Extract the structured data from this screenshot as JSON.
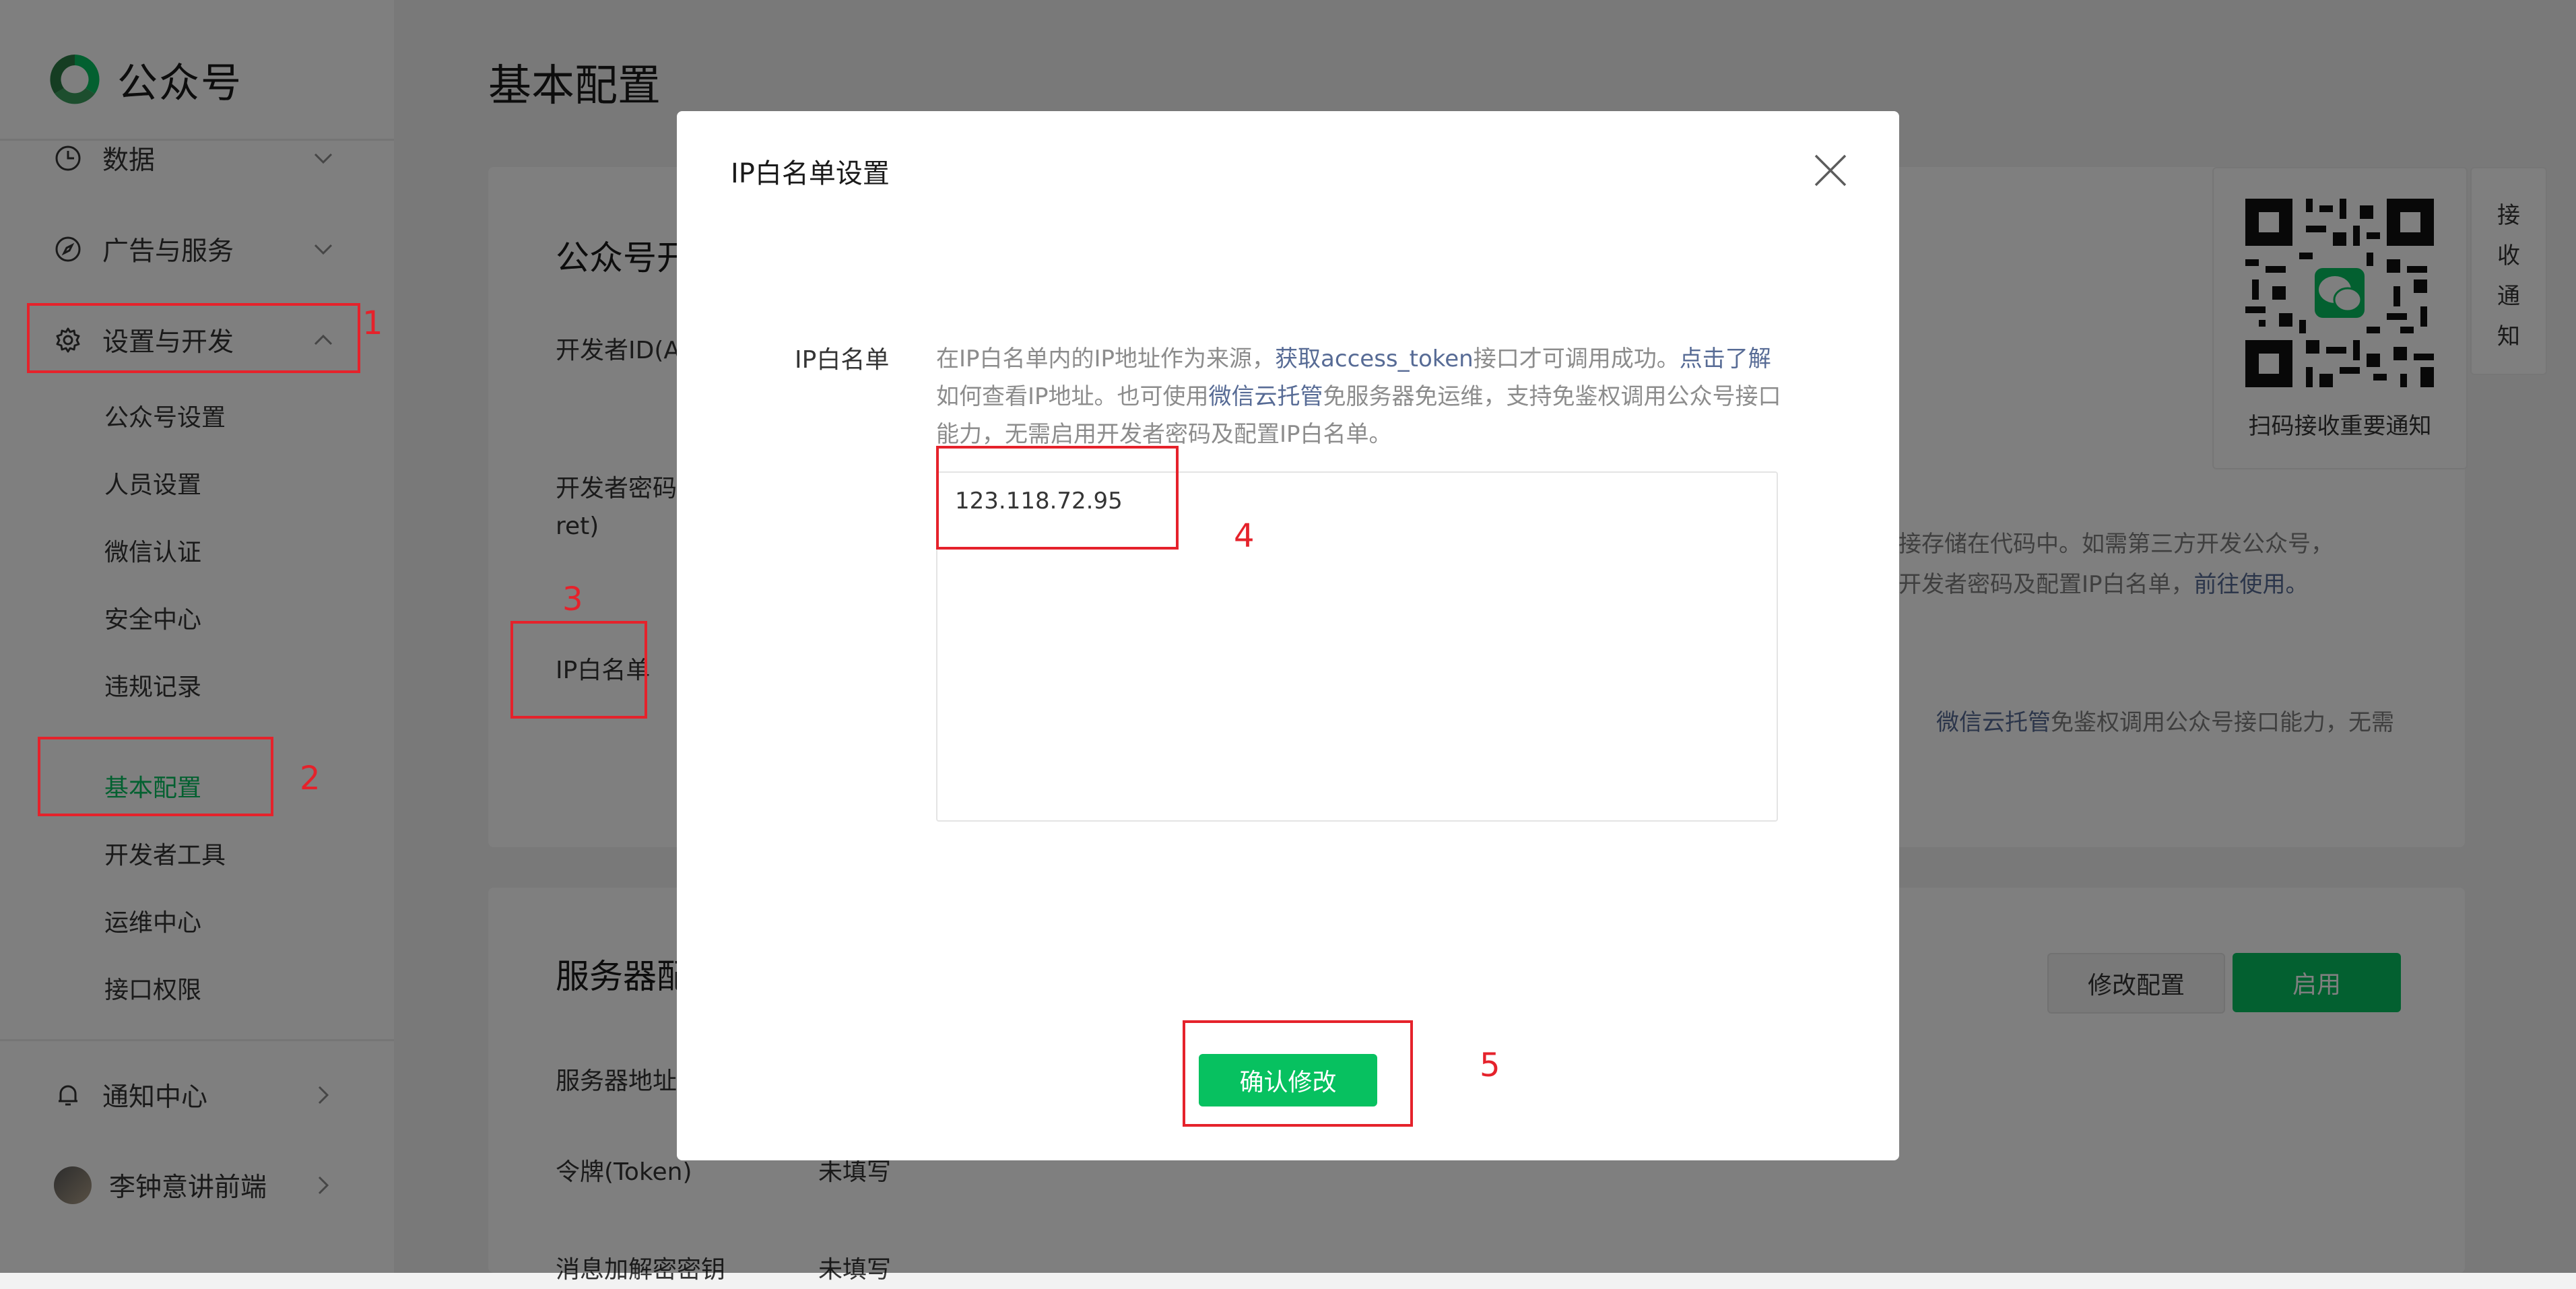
{
  "sidebar": {
    "logo_text": "公众号",
    "nav": [
      {
        "label": "数据",
        "icon": "clock-icon"
      },
      {
        "label": "广告与服务",
        "icon": "compass-icon"
      },
      {
        "label": "设置与开发",
        "icon": "gear-icon"
      }
    ],
    "sub_items": [
      "公众号设置",
      "人员设置",
      "微信认证",
      "安全中心",
      "违规记录",
      "基本配置",
      "开发者工具",
      "运维中心",
      "接口权限"
    ],
    "active_sub": "基本配置",
    "notify": {
      "label": "通知中心",
      "icon": "bell-icon"
    },
    "user": {
      "name": "李钟意讲前端"
    }
  },
  "main": {
    "page_title": "基本配置",
    "dev_card": {
      "title": "公众号开",
      "dev_id_label": "开发者ID(A",
      "secret_label_l1": "开发者密码(",
      "secret_label_l2": "ret)",
      "ip_label": "IP白名单",
      "right_line1": "直接存储在代码中。如需第三方开发公众号，",
      "right_line2_a": "用开发者密码及配置IP白名单，",
      "right_line2_link": "前往使用。",
      "right_line3_a": "用",
      "right_line3_link": "微信云托管",
      "right_line3_b": "免鉴权调用公众号接口能力，无需"
    },
    "server_card": {
      "title": "服务器配",
      "modify_button": "修改配置",
      "enable_button": "启用",
      "address_label": "服务器地址(",
      "token_label": "令牌(Token)",
      "token_value": "未填写",
      "aeskey_label": "消息加解密密钥",
      "aeskey_value": "未填写"
    },
    "qr": {
      "caption": "扫码接收重要通知"
    },
    "notify_tab": "接\n收\n通\n知"
  },
  "modal": {
    "title": "IP白名单设置",
    "field_label": "IP白名单",
    "desc_1": "在IP白名单内的IP地址作为来源，",
    "desc_link_1": "获取access_token",
    "desc_2": "接口才可调用成功。",
    "desc_link_2": "点击了解",
    "desc_3": "如何查看IP地址。也可使用",
    "desc_link_3": "微信云托管",
    "desc_4": "免服务器免运维，支持免鉴权调用公众号接口能力，无需启用开发者密码及配置IP白名单。",
    "ip_value": "123.118.72.95",
    "confirm_button": "确认修改"
  },
  "annotations": [
    "1",
    "2",
    "3",
    "4",
    "5"
  ],
  "colors": {
    "accent": "#07c160",
    "link": "#576b95",
    "annotation": "#e5222b"
  }
}
